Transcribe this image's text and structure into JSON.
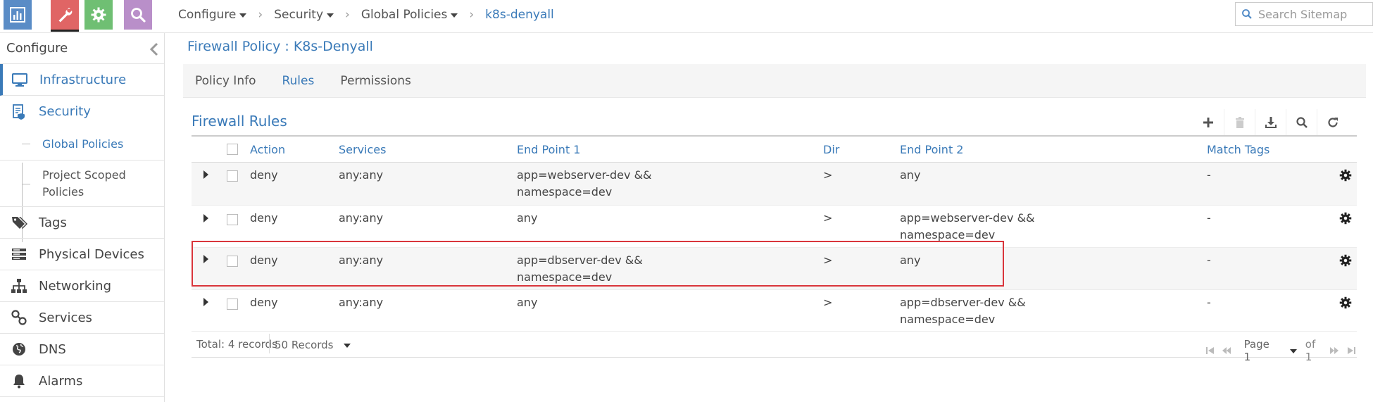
{
  "topbar": {
    "buttons": [
      {
        "name": "monitor",
        "icon": "bar-chart-icon",
        "color": "#5a8cc6"
      },
      {
        "name": "configure",
        "icon": "wrench-icon",
        "color": "#e06565"
      },
      {
        "name": "settings",
        "icon": "gear-icon",
        "color": "#6fbf73"
      },
      {
        "name": "query",
        "icon": "search-icon",
        "color": "#b98fc9"
      }
    ],
    "breadcrumb": [
      "Configure",
      "Security",
      "Global Policies",
      "k8s-denyall"
    ],
    "search_placeholder": "Search Sitemap"
  },
  "sidebar": {
    "header": "Configure",
    "items": [
      {
        "label": "Infrastructure",
        "icon": "monitor-icon"
      },
      {
        "label": "Security",
        "icon": "security-doc-icon"
      },
      {
        "label": "Global Policies"
      },
      {
        "label": "Project Scoped Policies"
      },
      {
        "label": "Tags",
        "icon": "tags-icon"
      },
      {
        "label": "Physical Devices",
        "icon": "server-icon"
      },
      {
        "label": "Networking",
        "icon": "network-icon"
      },
      {
        "label": "Services",
        "icon": "link-icon"
      },
      {
        "label": "DNS",
        "icon": "globe-icon"
      },
      {
        "label": "Alarms",
        "icon": "bell-icon"
      }
    ]
  },
  "main": {
    "title": "Firewall Policy : K8s-Denyall",
    "tabs": [
      "Policy Info",
      "Rules",
      "Permissions"
    ],
    "active_tab": "Rules",
    "section_title": "Firewall Rules",
    "tools": [
      "plus-icon",
      "trash-icon",
      "download-icon",
      "search-icon",
      "refresh-icon"
    ],
    "table": {
      "headers": [
        "Action",
        "Services",
        "End Point 1",
        "Dir",
        "End Point 2",
        "Match Tags"
      ],
      "rows": [
        {
          "action": "deny",
          "services": "any:any",
          "ep1": [
            "app=webserver-dev &&",
            "namespace=dev"
          ],
          "dir": ">",
          "ep2": [
            "any"
          ],
          "tags": "-"
        },
        {
          "action": "deny",
          "services": "any:any",
          "ep1": [
            "any"
          ],
          "dir": ">",
          "ep2": [
            "app=webserver-dev &&",
            "namespace=dev"
          ],
          "tags": "-"
        },
        {
          "action": "deny",
          "services": "any:any",
          "ep1": [
            "app=dbserver-dev &&",
            "namespace=dev"
          ],
          "dir": ">",
          "ep2": [
            "any"
          ],
          "tags": "-"
        },
        {
          "action": "deny",
          "services": "any:any",
          "ep1": [
            "any"
          ],
          "dir": ">",
          "ep2": [
            "app=dbserver-dev &&",
            "namespace=dev"
          ],
          "tags": "-"
        }
      ]
    },
    "footer": {
      "total": "Total: 4 records",
      "per_page": "50 Records",
      "page": "Page 1",
      "of": "of 1"
    },
    "highlight_color": "#d9353b"
  }
}
